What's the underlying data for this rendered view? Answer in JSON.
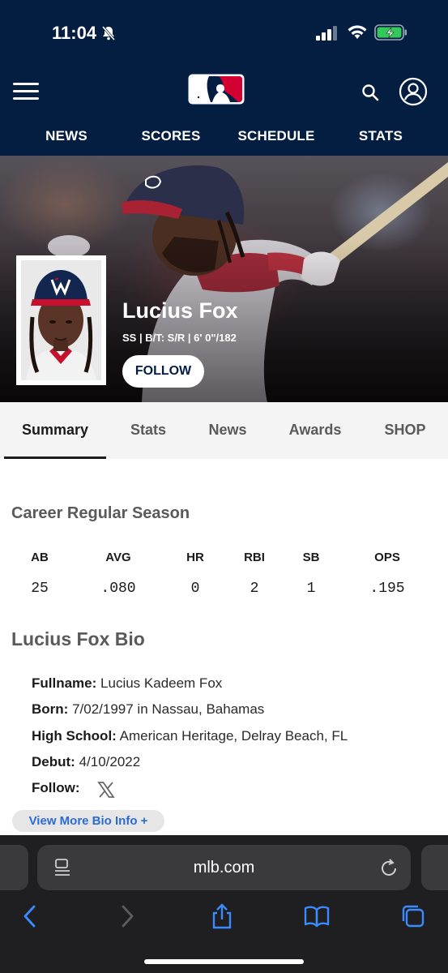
{
  "status_bar": {
    "time": "11:04"
  },
  "header": {
    "logo_icon": "mlb-logo-icon",
    "menu_icon": "hamburger-menu-icon",
    "search_icon": "search-icon",
    "account_icon": "user-account-icon",
    "nav": [
      {
        "label": "NEWS"
      },
      {
        "label": "SCORES"
      },
      {
        "label": "SCHEDULE"
      },
      {
        "label": "STATS"
      }
    ],
    "background_color": "#041e42"
  },
  "player": {
    "name": "Lucius Fox",
    "meta": "SS | B/T: S/R | 6' 0\"/182",
    "follow_label": "FOLLOW"
  },
  "tabs": [
    {
      "label": "Summary",
      "active": true
    },
    {
      "label": "Stats"
    },
    {
      "label": "News"
    },
    {
      "label": "Awards"
    },
    {
      "label": "SHOP"
    }
  ],
  "career": {
    "title": "Career Regular Season",
    "columns": [
      "AB",
      "AVG",
      "HR",
      "RBI",
      "SB",
      "OPS"
    ],
    "values": [
      "25",
      ".080",
      "0",
      "2",
      "1",
      ".195"
    ]
  },
  "bio": {
    "title": "Lucius Fox Bio",
    "rows": [
      {
        "label": "Fullname:",
        "value": "Lucius Kadeem Fox"
      },
      {
        "label": "Born:",
        "value": "7/02/1997 in Nassau, Bahamas"
      },
      {
        "label": "High School:",
        "value": "American Heritage, Delray Beach, FL"
      },
      {
        "label": "Debut:",
        "value": "4/10/2022"
      },
      {
        "label": "Follow:",
        "value": ""
      }
    ],
    "follow_icon": "x-twitter-icon",
    "more_label": "View More Bio Info +"
  },
  "browser": {
    "url": "mlb.com",
    "toolbar_icons": [
      "back-icon",
      "forward-icon",
      "share-icon",
      "bookmarks-icon",
      "tabs-icon"
    ]
  }
}
